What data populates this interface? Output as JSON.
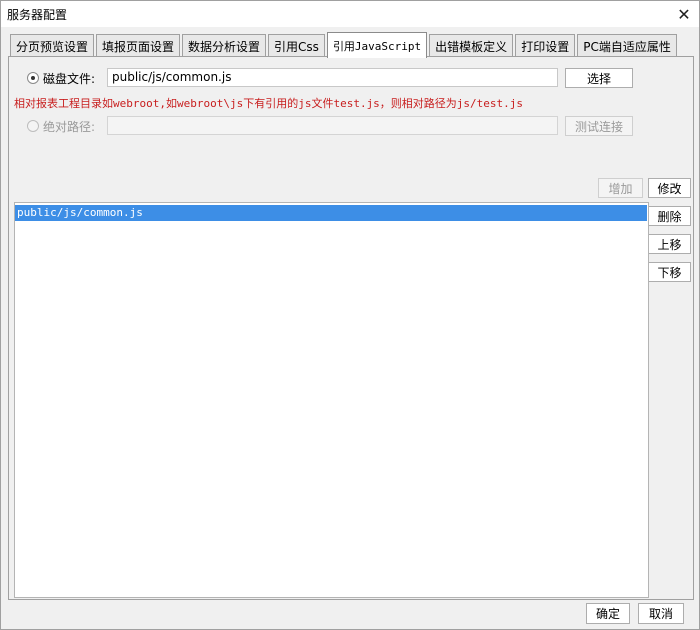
{
  "window": {
    "title": "服务器配置",
    "close_label": "✕"
  },
  "tabs": [
    {
      "label": "分页预览设置"
    },
    {
      "label": "填报页面设置"
    },
    {
      "label": "数据分析设置"
    },
    {
      "label": "引用Css"
    },
    {
      "label": "引用JavaScript"
    },
    {
      "label": "出错模板定义"
    },
    {
      "label": "打印设置"
    },
    {
      "label": "PC端自适应属性"
    }
  ],
  "disk_file": {
    "label": "磁盘文件:",
    "value": "public/js/common.js",
    "select_label": "选择"
  },
  "hint": "相对报表工程目录如webroot,如webroot\\js下有引用的js文件test.js，则相对路径为js/test.js",
  "abs_path": {
    "label": "绝对路径:",
    "value": "",
    "test_label": "测试连接"
  },
  "list_buttons": {
    "add": "增加",
    "edit": "修改",
    "delete": "删除",
    "up": "上移",
    "down": "下移"
  },
  "list_items": [
    "public/js/common.js"
  ],
  "footer": {
    "ok": "确定",
    "cancel": "取消"
  }
}
